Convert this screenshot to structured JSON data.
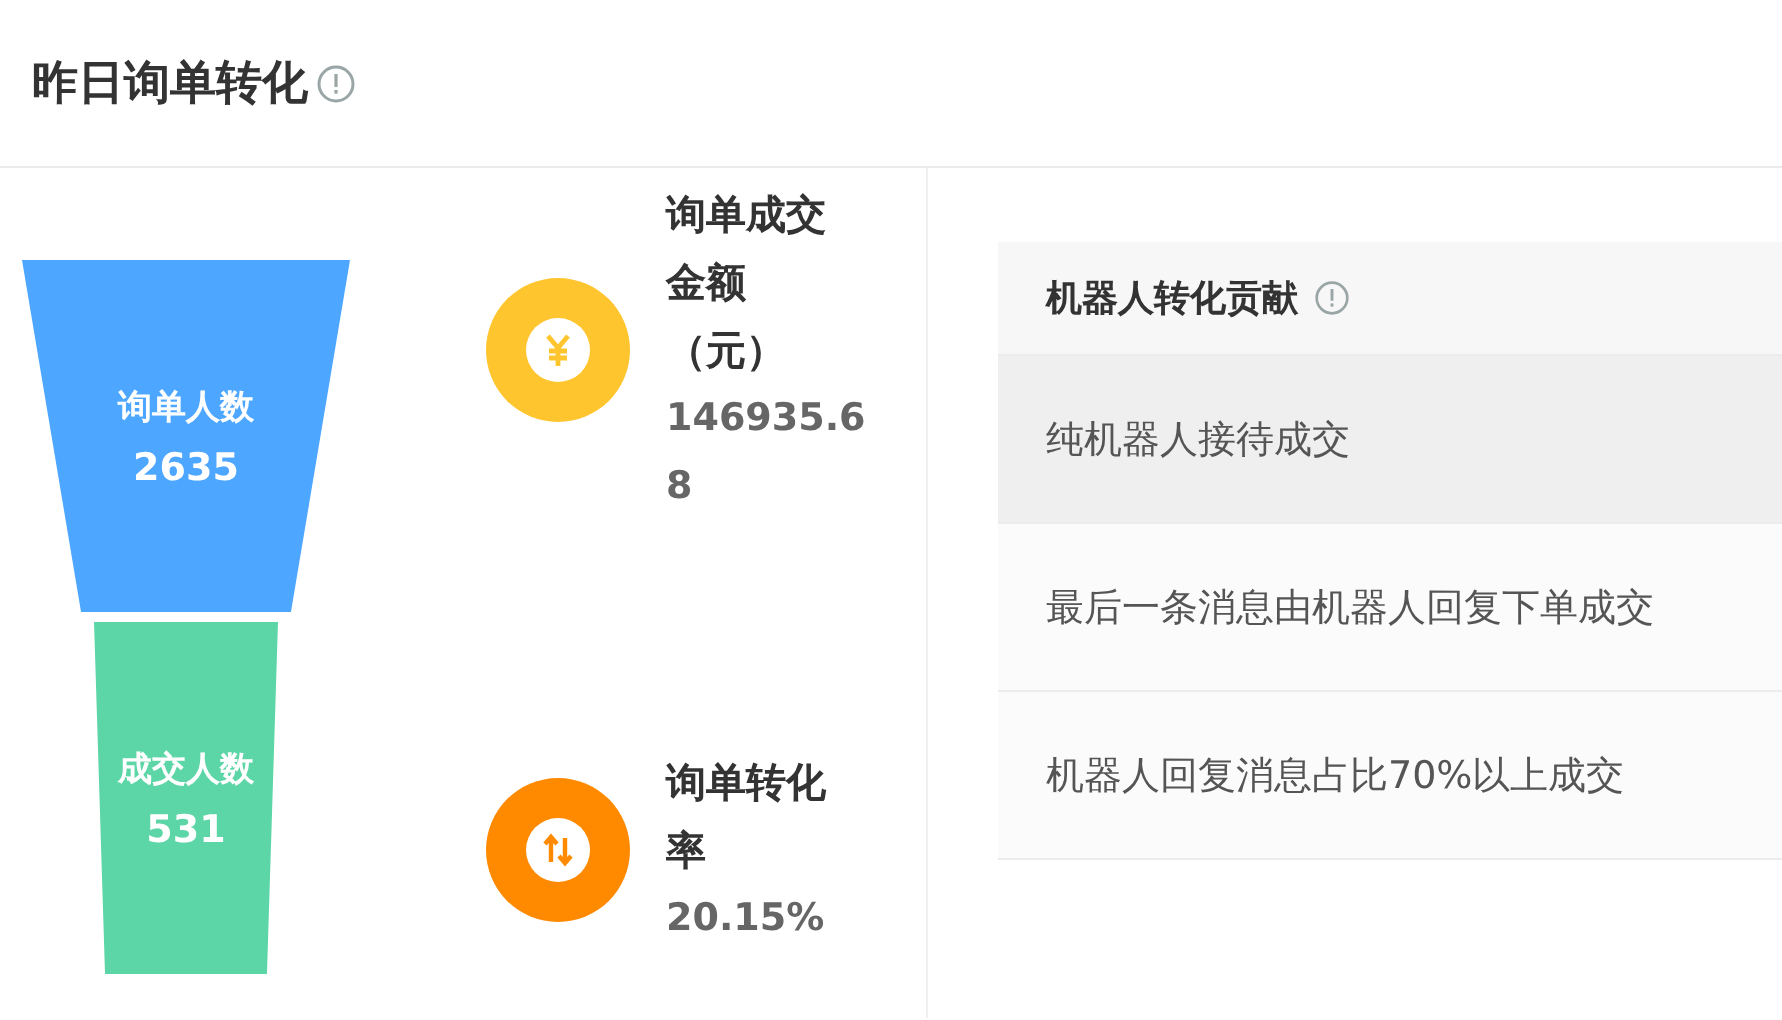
{
  "header": {
    "title": "昨日询单转化"
  },
  "funnel": [
    {
      "label": "询单人数",
      "value": "2635",
      "color": "#4da6ff"
    },
    {
      "label": "成交人数",
      "value": "531",
      "color": "#5cd6a6"
    }
  ],
  "stats": [
    {
      "kind": "yuan",
      "title": "询单成交金额（元）",
      "value": "146935.68",
      "color": "#ffc52e"
    },
    {
      "kind": "updown",
      "title": "询单转化率",
      "value": "20.15%",
      "color": "#ff8a00"
    }
  ],
  "contribution": {
    "title": "机器人转化贡献",
    "rows": [
      {
        "label": "纯机器人接待成交",
        "highlighted": true
      },
      {
        "label": "最后一条消息由机器人回复下单成交",
        "highlighted": false
      },
      {
        "label": "机器人回复消息占比70%以上成交",
        "highlighted": false
      }
    ]
  }
}
